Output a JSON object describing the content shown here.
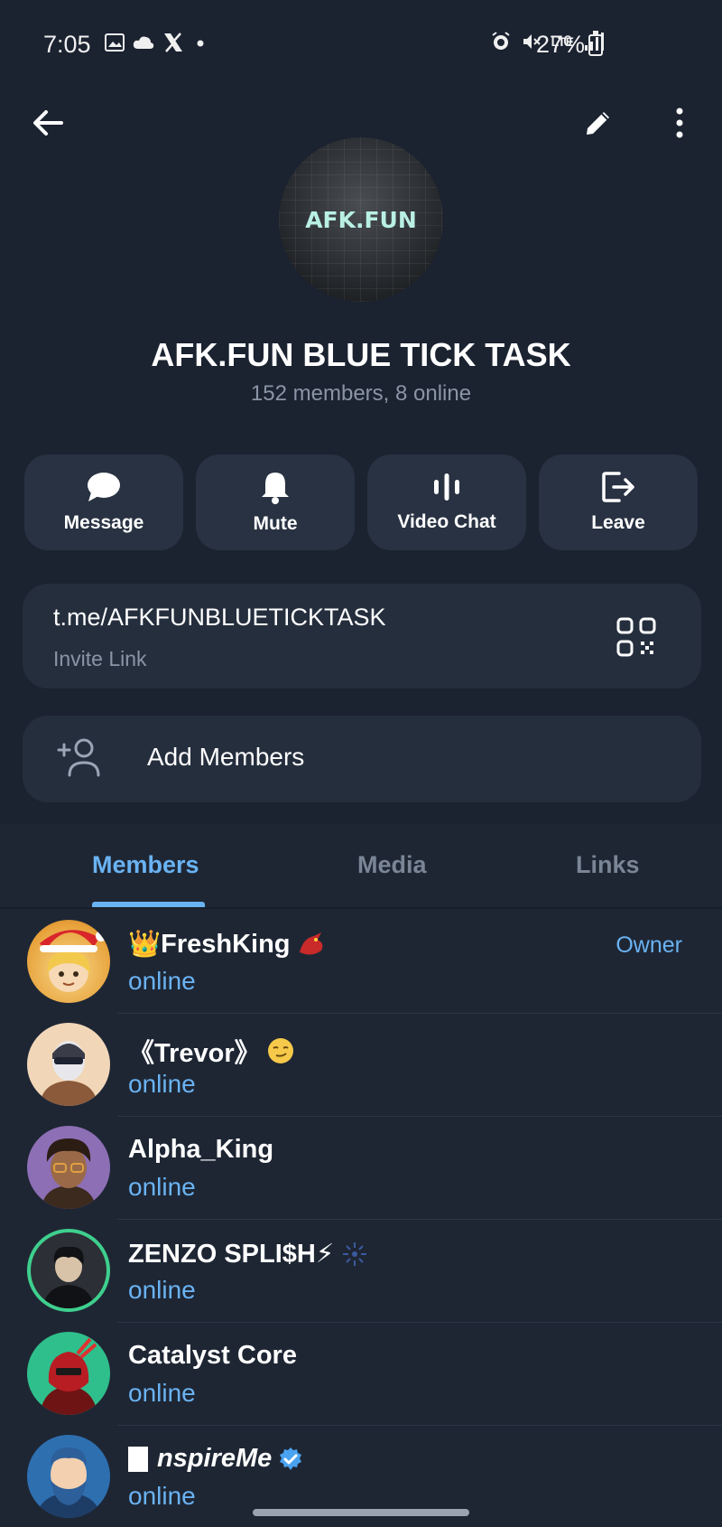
{
  "status_bar": {
    "time": "7:05",
    "network": "LTE",
    "battery": "27%"
  },
  "header": {
    "avatar_text": "AFK.FUN",
    "title": "AFK.FUN BLUE TICK TASK",
    "subtitle": "152 members, 8 online"
  },
  "actions": [
    {
      "label": "Message",
      "icon": "message-icon"
    },
    {
      "label": "Mute",
      "icon": "bell-icon"
    },
    {
      "label": "Video Chat",
      "icon": "video-chat-icon"
    },
    {
      "label": "Leave",
      "icon": "leave-icon"
    }
  ],
  "invite": {
    "url": "t.me/AFKFUNBLUETICKTASK",
    "label": "Invite Link"
  },
  "add_members": {
    "label": "Add Members"
  },
  "tabs": [
    {
      "label": "Members",
      "active": true
    },
    {
      "label": "Media",
      "active": false
    },
    {
      "label": "Links",
      "active": false
    }
  ],
  "members": [
    {
      "name": "👑FreshKing",
      "status": "online",
      "role": "Owner",
      "avatar_color": "#f2c34e"
    },
    {
      "name": "《Trevor》",
      "status": "online",
      "role": "",
      "avatar_color": "#f1d7b8"
    },
    {
      "name": "Alpha_King",
      "status": "online",
      "role": "",
      "avatar_color": "#8d6fb5"
    },
    {
      "name": "ZENZO SPLI$H⚡",
      "status": "online",
      "role": "",
      "avatar_color": "#2c2f35"
    },
    {
      "name": "Catalyst Core",
      "status": "online",
      "role": "",
      "avatar_color": "#2fbf8c"
    },
    {
      "name": "nspireMe",
      "status": "online",
      "role": "",
      "avatar_color": "#2e6fb0"
    }
  ],
  "colors": {
    "accent": "#6ab3f3",
    "background": "#1e2634",
    "card": "#252e3d"
  }
}
